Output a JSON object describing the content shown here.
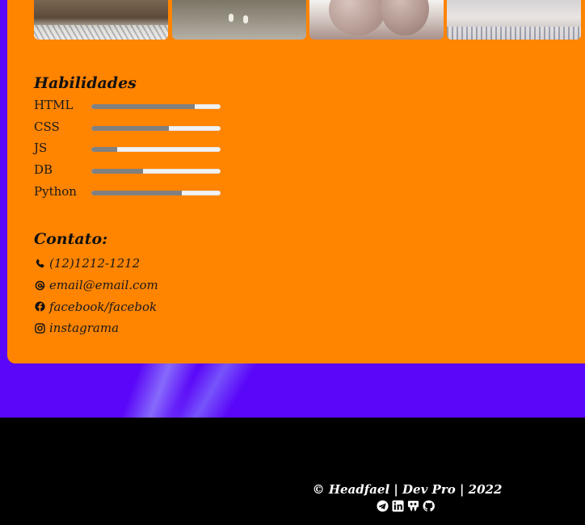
{
  "skills": {
    "title": "Habilidades",
    "items": [
      {
        "name": "HTML",
        "level": 80
      },
      {
        "name": "CSS",
        "level": 60
      },
      {
        "name": "JS",
        "level": 20
      },
      {
        "name": "DB",
        "level": 40
      },
      {
        "name": "Python",
        "level": 70
      }
    ]
  },
  "contact": {
    "title": "Contato:",
    "phone": "(12)1212-1212",
    "email": "email@email.com",
    "facebook": "facebook/facebok",
    "instagram": "instagrama"
  },
  "footer": {
    "text": "© Headfael | Dev Pro | 2022",
    "icons": [
      "telegram-icon",
      "linkedin-icon",
      "slideshare-icon",
      "github-icon"
    ]
  },
  "colors": {
    "card": "#ff8400",
    "background": "#5a06f8",
    "footer": "#000000",
    "bar_fill": "#808080",
    "bar_track": "#f2f2f2"
  }
}
